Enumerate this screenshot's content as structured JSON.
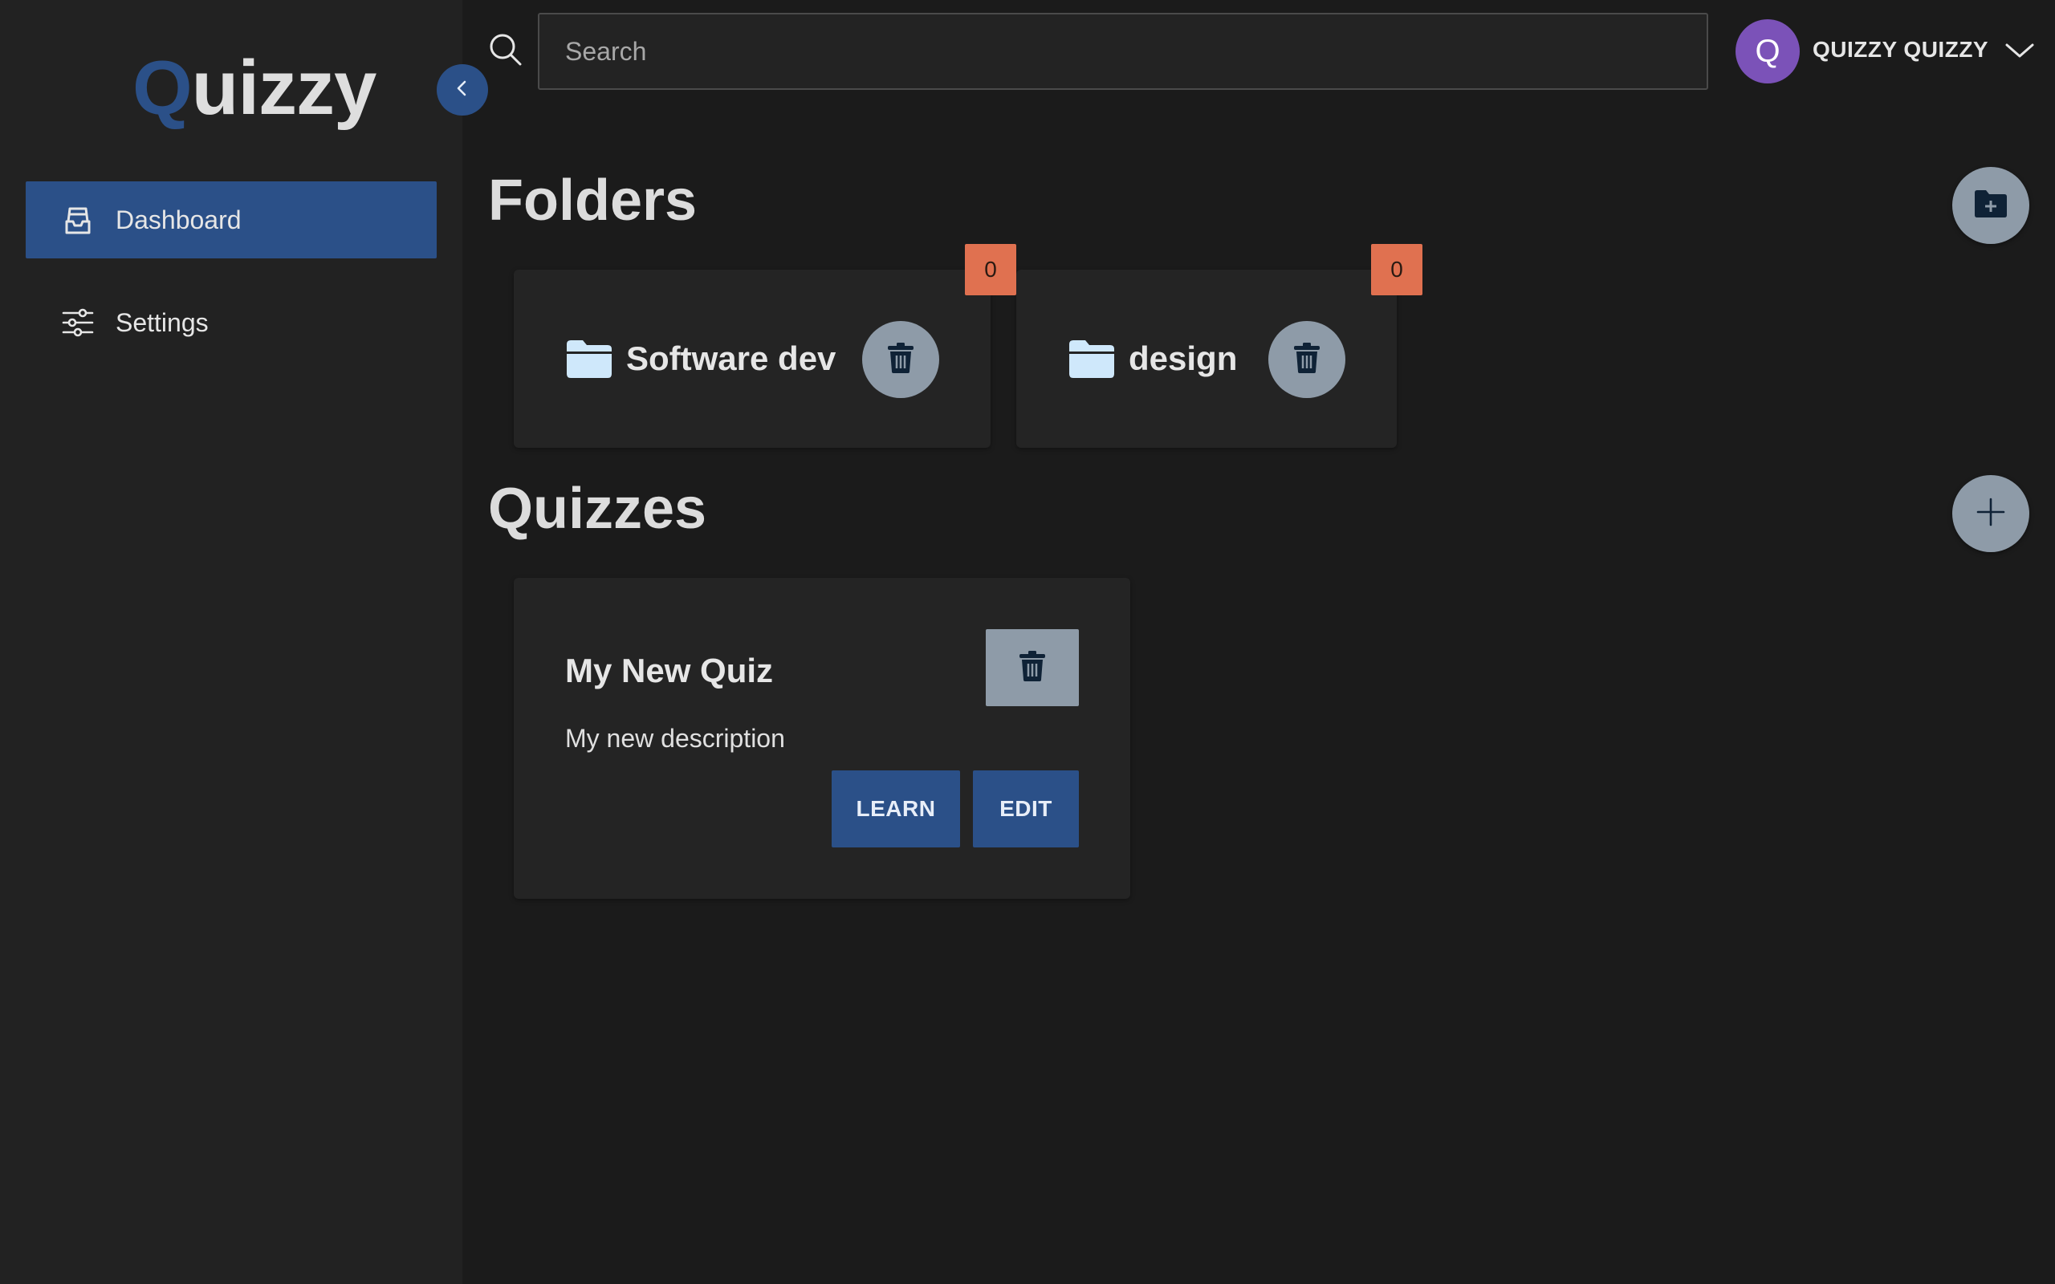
{
  "app": {
    "logo_initial": "Q",
    "logo_rest": "uizzy"
  },
  "sidebar": {
    "items": [
      {
        "label": "Dashboard",
        "icon": "inbox-stack-icon",
        "active": true
      },
      {
        "label": "Settings",
        "icon": "sliders-icon",
        "active": false
      }
    ]
  },
  "header": {
    "search_placeholder": "Search",
    "search_value": "",
    "user": {
      "initial": "Q",
      "name": "QUIZZY QUIZZY"
    }
  },
  "folders_section": {
    "title": "Folders",
    "folders": [
      {
        "name": "Software dev",
        "count": "0"
      },
      {
        "name": "design",
        "count": "0"
      }
    ]
  },
  "quizzes_section": {
    "title": "Quizzes",
    "quizzes": [
      {
        "title": "My New Quiz",
        "description": "My new description",
        "learn_label": "LEARN",
        "edit_label": "EDIT"
      }
    ]
  },
  "colors": {
    "accent": "#2b5088",
    "badge": "#e07150",
    "avatar": "#7b52b8",
    "button_gray": "#8e9ba8",
    "background": "#1b1b1b",
    "sidebar": "#222222"
  }
}
